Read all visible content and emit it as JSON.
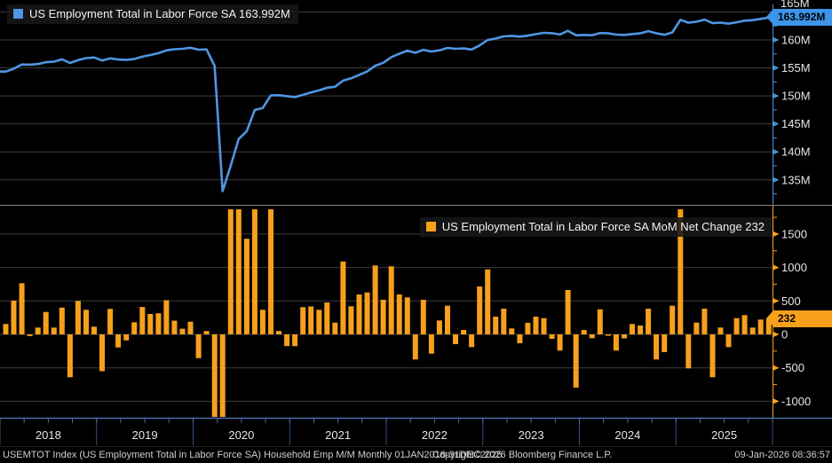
{
  "header_legend": {
    "top": "US Employment Total in Labor Force SA 163.992M",
    "bottom": "US Employment Total in Labor Force SA MoM Net Change 232"
  },
  "badges": {
    "top": "163.992M",
    "bottom": "232"
  },
  "axis": {
    "top_cut_label": "165M"
  },
  "footer": {
    "left": "USEMTOT Index (US Employment Total in Labor Force SA) Household Emp M/M Monthly 01JAN2018-31DEC2025",
    "center": "Copyright© 2026 Bloomberg Finance L.P.",
    "right": "09-Jan-2026 08:36:57"
  },
  "colors": {
    "line_blue": "#4f96e3",
    "badge_blue": "#3d94e8",
    "axis_blue": "#4a90d9",
    "bar_orange": "#f7a01c",
    "grid": "#3c3c3c",
    "panel_divider": "#888888",
    "x_axis": "#4a6ea8",
    "year_divider": "#33507a",
    "tick_text": "#e5e5e5",
    "footer_text": "#cfcfcf"
  },
  "chart_data": [
    {
      "type": "line",
      "title": "US Employment Total in Labor Force SA",
      "unit": "millions of persons",
      "freq": "monthly",
      "x_start": "2018-01",
      "x_end": "2025-12",
      "last_value": 163.992,
      "ylim": [
        130.6,
        165.9
      ],
      "grid": true,
      "y_ticks": [
        {
          "label": "165M",
          "value": 165
        },
        {
          "label": "160M",
          "value": 160
        },
        {
          "label": "155M",
          "value": 155
        },
        {
          "label": "150M",
          "value": 150
        },
        {
          "label": "145M",
          "value": 145
        },
        {
          "label": "140M",
          "value": 140
        },
        {
          "label": "135M",
          "value": 135
        }
      ],
      "y_minor": [
        162.5,
        157.5,
        152.5,
        147.5,
        142.5,
        137.5,
        132.5
      ],
      "values": [
        154.339,
        154.844,
        155.609,
        155.584,
        155.686,
        156.022,
        156.124,
        156.524,
        155.884,
        156.384,
        156.751,
        156.866,
        156.316,
        156.696,
        156.501,
        156.411,
        156.591,
        157.001,
        157.306,
        157.621,
        158.131,
        158.336,
        158.421,
        158.611,
        158.256,
        158.306,
        155.356,
        132.986,
        137.506,
        142.286,
        143.716,
        147.476,
        147.843,
        150.083,
        150.133,
        149.958,
        149.783,
        150.19,
        150.608,
        150.975,
        151.452,
        151.628,
        152.718,
        153.138,
        153.735,
        154.362,
        155.392,
        155.909,
        156.926,
        157.523,
        158.076,
        157.701,
        158.218,
        157.93,
        158.138,
        158.566,
        158.42,
        158.486,
        158.296,
        159.012,
        159.984,
        160.249,
        160.634,
        160.723,
        160.59,
        160.763,
        161.028,
        161.271,
        161.205,
        160.962,
        161.625,
        160.829,
        160.895,
        160.838,
        161.213,
        161.193,
        160.95,
        160.89,
        161.045,
        161.178,
        161.563,
        161.188,
        160.923,
        161.351,
        163.581,
        163.073,
        163.249,
        163.634,
        162.994,
        163.096,
        162.906,
        163.149,
        163.437,
        163.539,
        163.76,
        163.992
      ]
    },
    {
      "type": "bar",
      "title": "US Employment Total in Labor Force SA MoM Net Change",
      "unit": "thousands of persons",
      "freq": "monthly",
      "x_start": "2018-01",
      "x_end": "2025-12",
      "last_value": 232,
      "ylim": [
        -1233,
        1870
      ],
      "clipped_note": "bars beyond ylim are clipped at panel edges (Mar/Apr 2020, May/Jun/Aug/Oct 2020, Jan 2025)",
      "grid": true,
      "y_ticks": [
        {
          "label": "1500",
          "value": 1500
        },
        {
          "label": "1000",
          "value": 1000
        },
        {
          "label": "500",
          "value": 500
        },
        {
          "label": "0",
          "value": 0
        },
        {
          "label": "-500",
          "value": -500
        },
        {
          "label": "-1000",
          "value": -1000
        }
      ],
      "y_minor": [
        1750,
        1250,
        750,
        250,
        -250,
        -750
      ],
      "x_year_labels": [
        "2018",
        "2019",
        "2020",
        "2021",
        "2022",
        "2023",
        "2024",
        "2025"
      ],
      "values": [
        155,
        505,
        765,
        -25,
        102,
        336,
        102,
        400,
        -640,
        500,
        367,
        115,
        -550,
        380,
        -195,
        -90,
        180,
        410,
        305,
        315,
        510,
        205,
        85,
        190,
        -355,
        50,
        -2950,
        -22370,
        4520,
        4780,
        1430,
        3760,
        367,
        2240,
        50,
        -175,
        -175,
        407,
        418,
        367,
        477,
        176,
        1090,
        420,
        597,
        627,
        1030,
        517,
        1017,
        597,
        553,
        -375,
        517,
        -288,
        208,
        428,
        -146,
        66,
        -190,
        716,
        972,
        265,
        385,
        89,
        -133,
        173,
        265,
        243,
        -66,
        -243,
        663,
        -796,
        66,
        -57,
        375,
        -20,
        -243,
        -60,
        155,
        133,
        385,
        -375,
        -265,
        428,
        2230,
        -508,
        176,
        385,
        -640,
        102,
        -190,
        243,
        288,
        102,
        221,
        232
      ]
    }
  ]
}
